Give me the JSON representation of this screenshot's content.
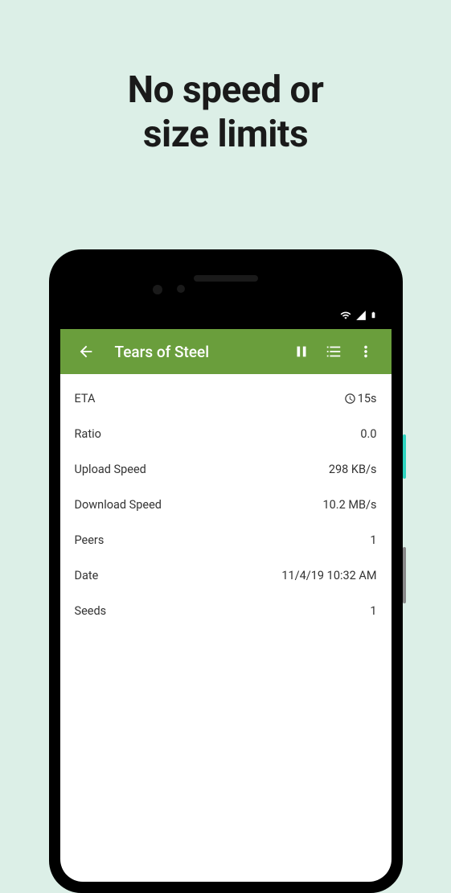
{
  "headline_line1": "No speed or",
  "headline_line2": "size limits",
  "appbar": {
    "title": "Tears of Steel"
  },
  "details": {
    "eta_label": "ETA",
    "eta_value": "15s",
    "ratio_label": "Ratio",
    "ratio_value": "0.0",
    "upload_label": "Upload Speed",
    "upload_value": "298 KB/s",
    "download_label": "Download Speed",
    "download_value": "10.2 MB/s",
    "peers_label": "Peers",
    "peers_value": "1",
    "date_label": "Date",
    "date_value": "11/4/19 10:32 AM",
    "seeds_label": "Seeds",
    "seeds_value": "1"
  }
}
